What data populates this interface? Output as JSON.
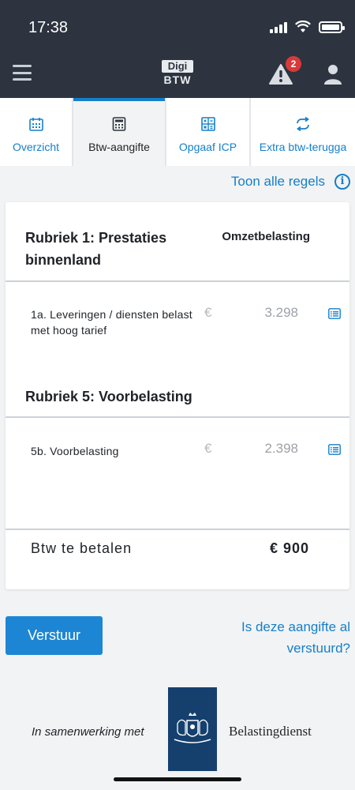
{
  "status_bar": {
    "time": "17:38"
  },
  "header": {
    "logo_top": "Digi",
    "logo_bottom": "BTW",
    "notification_count": "2"
  },
  "tabs": [
    {
      "label": "Overzicht",
      "icon": "calendar-icon",
      "active": false
    },
    {
      "label": "Btw-aangifte",
      "icon": "calculator-icon",
      "active": true
    },
    {
      "label": "Opgaaf ICP",
      "icon": "calculator-grid-icon",
      "active": false
    },
    {
      "label": "Extra btw-terugga",
      "icon": "exchange-arrows-icon",
      "active": false
    }
  ],
  "toolbar": {
    "show_all_rows": "Toon alle regels"
  },
  "declaration": {
    "rubriek1_title": "Rubriek 1: Prestaties binnenland",
    "column_header": "Omzetbelasting",
    "row_1a_label": "1a. Leveringen / diensten belast met hoog tarief",
    "row_1a_currency": "€",
    "row_1a_amount": "3.298",
    "rubriek5_title": "Rubriek 5: Voorbelasting",
    "row_5b_label": "5b. Voorbelasting",
    "row_5b_currency": "€",
    "row_5b_amount": "2.398",
    "total_label": "Btw te betalen",
    "total_amount": "€ 900"
  },
  "actions": {
    "send_label": "Verstuur",
    "already_sent_link": "Is deze aangifte al verstuurd?"
  },
  "footer": {
    "cooperation_text": "In samenwerking met",
    "partner_name": "Belastingdienst"
  },
  "colors": {
    "header_bg": "#2d3440",
    "accent": "#157fc9",
    "button_bg": "#1d86d4",
    "badge": "#d73a3a",
    "crest_bg": "#15406e"
  }
}
